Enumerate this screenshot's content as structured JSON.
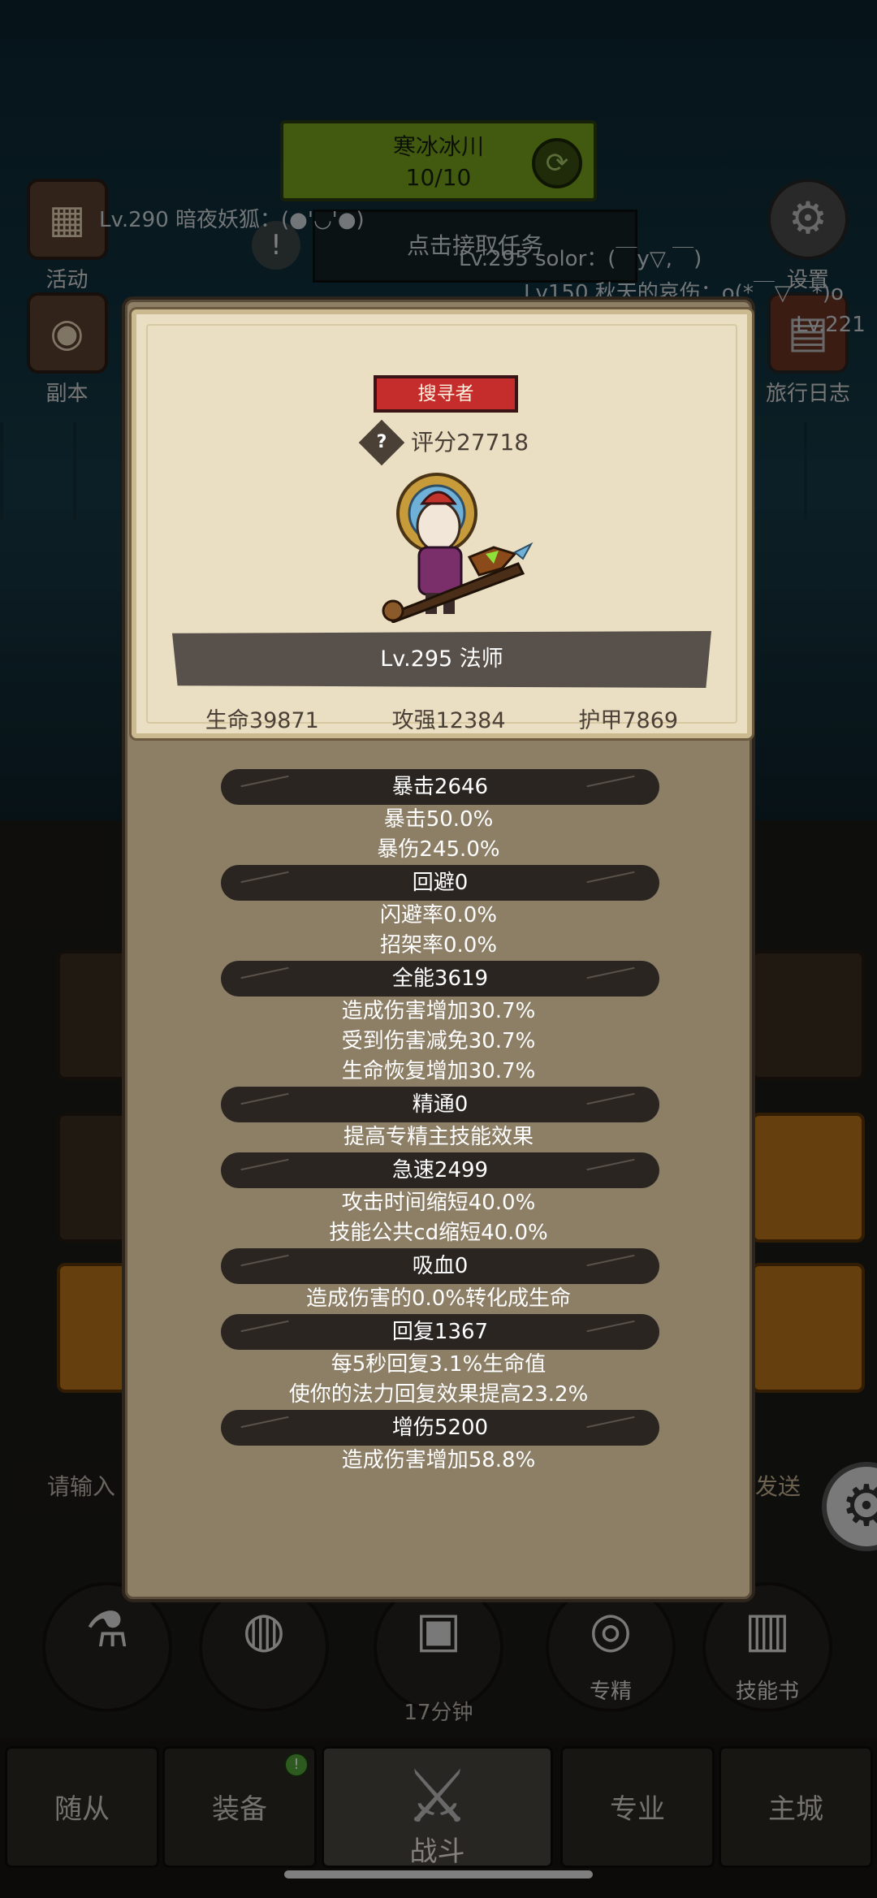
{
  "hud": {
    "stage_name": "寒冰冰川",
    "stage_progress": "10/10",
    "activity_label": "活动",
    "dungeon_label": "副本",
    "settings_label": "设置",
    "journal_label": "旅行日志",
    "task_prompt": "点击接取任务",
    "chat_lines": [
      "Lv.290 暗夜妖狐：(●'◡'●)",
      "Lv.295 solor：(￣y▽,￣)",
      "Lv150 秋天的哀伤：o(*￣▽￣*)o",
      "Lv.221"
    ]
  },
  "chat": {
    "input_placeholder": "请输入",
    "send_label": "发送"
  },
  "bottom_actions": {
    "timer": "17分钟",
    "specialty_label": "专精",
    "skillbook_label": "技能书"
  },
  "nav": {
    "notification_count": "!",
    "tabs": [
      "随从",
      "装备",
      "战斗",
      "专业",
      "主城"
    ]
  },
  "panel": {
    "badge": "搜寻者",
    "score": "评分27718",
    "level_class": "Lv.295 法师",
    "stats": [
      "生命39871",
      "攻强12384",
      "护甲7869"
    ],
    "sections": [
      {
        "header": "暴击2646",
        "lines": [
          "暴击50.0%",
          "暴伤245.0%"
        ]
      },
      {
        "header": "回避0",
        "lines": [
          "闪避率0.0%",
          "招架率0.0%"
        ]
      },
      {
        "header": "全能3619",
        "lines": [
          "造成伤害增加30.7%",
          "受到伤害减免30.7%",
          "生命恢复增加30.7%"
        ]
      },
      {
        "header": "精通0",
        "lines": [
          "提高专精主技能效果"
        ]
      },
      {
        "header": "急速2499",
        "lines": [
          "攻击时间缩短40.0%",
          "技能公共cd缩短40.0%"
        ]
      },
      {
        "header": "吸血0",
        "lines": [
          "造成伤害的0.0%转化成生命"
        ]
      },
      {
        "header": "回复1367",
        "lines": [
          "每5秒回复3.1%生命值",
          "使你的法力回复效果提高23.2%"
        ]
      },
      {
        "header": "增伤5200",
        "lines": [
          "造成伤害增加58.8%"
        ]
      }
    ]
  }
}
